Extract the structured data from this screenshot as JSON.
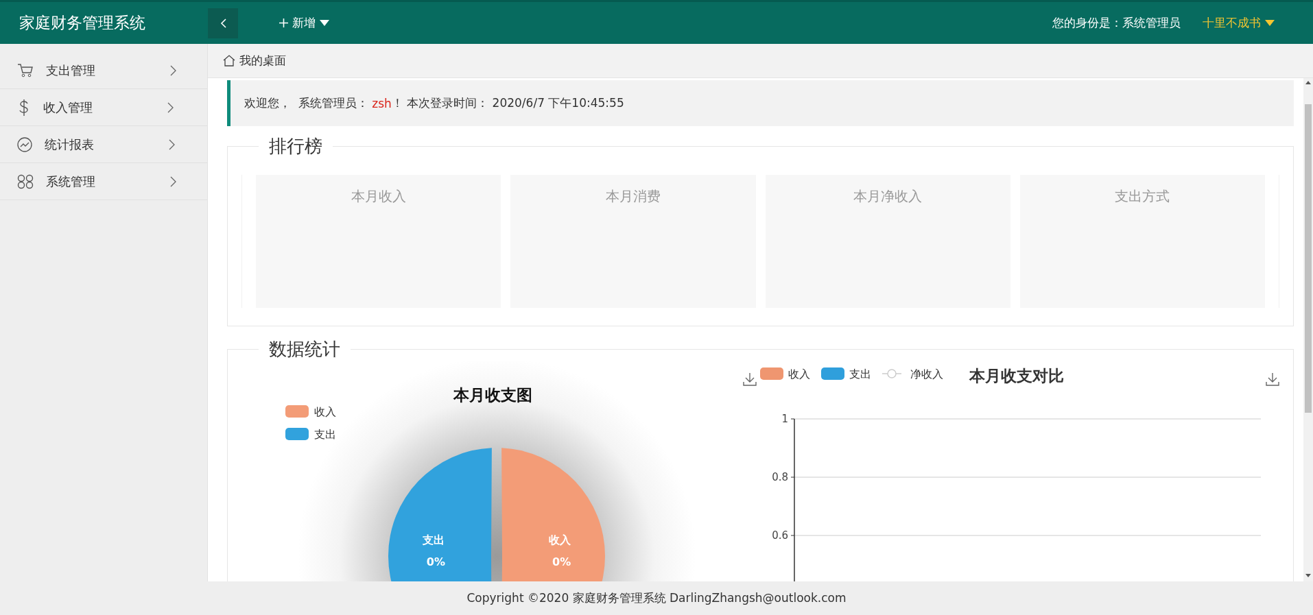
{
  "header": {
    "logo": "家庭财务管理系统",
    "add_menu": "新增",
    "role_label": "您的身份是：系统管理员",
    "user_name": "十里不成书"
  },
  "sidebar": {
    "items": [
      {
        "label": "支出管理",
        "kind": "cart"
      },
      {
        "label": "收入管理",
        "kind": "dollar"
      },
      {
        "label": "统计报表",
        "kind": "trend"
      },
      {
        "label": "系统管理",
        "kind": "command"
      }
    ]
  },
  "breadcrumb": "我的桌面",
  "welcome": {
    "greeting": "欢迎您，",
    "role": "系统管理员：",
    "user": "zsh",
    "exclaim": "！",
    "login_label": "本次登录时间：",
    "login_time": "2020/6/7 下午10:45:55"
  },
  "ranking": {
    "title": "排行榜",
    "cards": [
      "本月收入",
      "本月消费",
      "本月净收入",
      "支出方式"
    ]
  },
  "stats": {
    "title": "数据统计",
    "pie": {
      "legend": [
        {
          "label": "收入",
          "color": "#f39c77"
        },
        {
          "label": "支出",
          "color": "#31a2dd"
        }
      ],
      "slices": [
        {
          "percent": "0%",
          "color": "#31a2dd"
        },
        {
          "percent": "0%",
          "color": "#f39c77"
        }
      ],
      "chart_data": {
        "type": "pie",
        "title": "本月收支图",
        "categories": [
          "支出",
          "收入"
        ],
        "values": [
          50,
          50
        ]
      }
    },
    "bar": {
      "legend": [
        {
          "kind": "bar"
        },
        {
          "kind": "bar"
        },
        {
          "kind": "line"
        }
      ],
      "chart_data": {
        "type": "bar",
        "title": "本月收支对比",
        "series": [
          {
            "name": "收入",
            "color": "#ef9670"
          },
          {
            "name": "支出",
            "color": "#2f9fdc"
          },
          {
            "name": "净收入",
            "color": "#cccccc"
          }
        ],
        "ylim": [
          0,
          1
        ],
        "yticks": [
          1,
          0.8,
          0.6
        ]
      }
    }
  },
  "footer": "Copyright ©2020 家庭财务管理系统 DarlingZhangsh@outlook.com"
}
